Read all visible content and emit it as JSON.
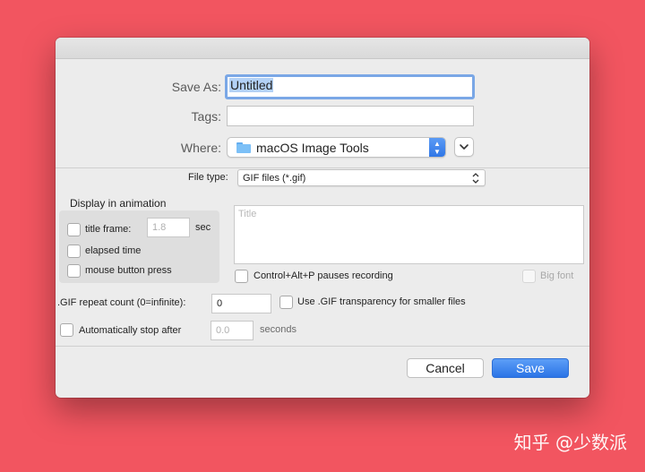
{
  "dialog": {
    "save_as_label": "Save As:",
    "save_as_value": "Untitled",
    "tags_label": "Tags:",
    "tags_value": "",
    "where_label": "Where:",
    "where_value": "macOS Image Tools",
    "file_type_label": "File type:",
    "file_type_value": "GIF files (*.gif)"
  },
  "animation": {
    "section_label": "Display in animation",
    "title_frame_label": "title frame:",
    "title_frame_value": "1.8",
    "title_frame_unit": "sec",
    "elapsed_time_label": "elapsed time",
    "mouse_press_label": "mouse button press",
    "title_placeholder": "Title",
    "pause_hotkey_label": "Control+Alt+P pauses recording",
    "big_font_label": "Big font"
  },
  "gif_options": {
    "repeat_label": ".GIF repeat count (0=infinite):",
    "repeat_value": "0",
    "transparency_label": "Use .GIF transparency for smaller files",
    "auto_stop_label": "Automatically stop after",
    "auto_stop_value": "0.0",
    "auto_stop_unit": "seconds"
  },
  "buttons": {
    "cancel": "Cancel",
    "save": "Save"
  },
  "watermark": "知乎 @少数派",
  "colors": {
    "background": "#f25560",
    "accent": "#2f76e6"
  }
}
